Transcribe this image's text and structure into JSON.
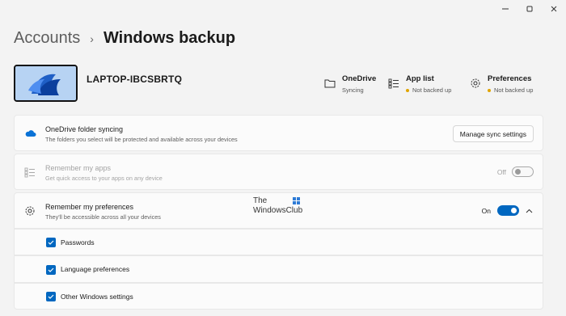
{
  "window": {
    "minimize_icon": "minimize-icon",
    "maximize_icon": "maximize-icon",
    "close_icon": "close-icon"
  },
  "breadcrumb": {
    "parent": "Accounts",
    "separator": "›",
    "current": "Windows backup"
  },
  "device": {
    "name": "LAPTOP-IBCSBRTQ"
  },
  "status": [
    {
      "title": "OneDrive",
      "sub": "Syncing",
      "icon": "folder-icon",
      "warn": false
    },
    {
      "title": "App list",
      "sub": "Not backed up",
      "icon": "app-list-icon",
      "warn": true
    },
    {
      "title": "Preferences",
      "sub": "Not backed up",
      "icon": "gear-icon",
      "warn": true
    }
  ],
  "onedrive": {
    "title": "OneDrive folder syncing",
    "sub": "The folders you select will be protected and available across your devices",
    "button": "Manage sync settings",
    "icon": "cloud-icon"
  },
  "apps": {
    "title": "Remember my apps",
    "sub": "Get quick access to your apps on any device",
    "toggle_label": "Off",
    "toggle_state": "off",
    "icon": "app-list-icon"
  },
  "preferences": {
    "title": "Remember my preferences",
    "sub": "They'll be accessible across all your devices",
    "toggle_label": "On",
    "toggle_state": "on",
    "icon": "gear-icon",
    "items": [
      {
        "label": "Passwords",
        "checked": true
      },
      {
        "label": "Language preferences",
        "checked": true
      },
      {
        "label": "Other Windows settings",
        "checked": true
      }
    ]
  },
  "watermark": {
    "line1": "The",
    "line2": "WindowsClub"
  },
  "colors": {
    "accent": "#0067c0",
    "warning": "#e0a400",
    "background": "#f3f3f3"
  }
}
